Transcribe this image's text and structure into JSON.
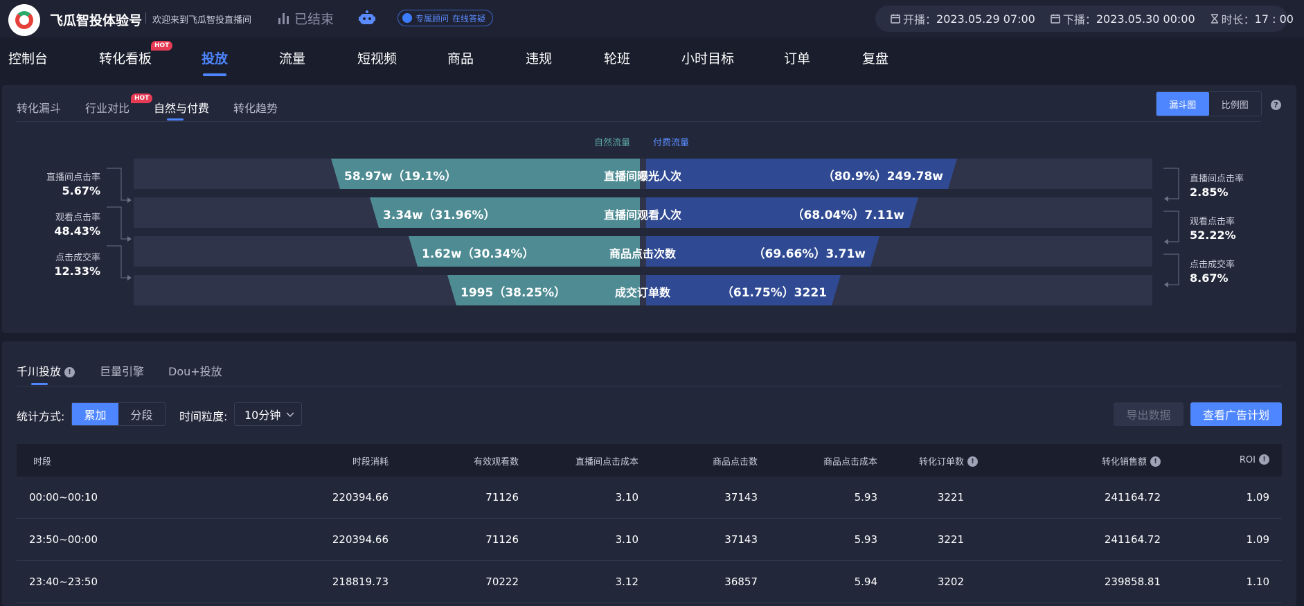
{
  "header": {
    "brand": "飞瓜智投体验号",
    "welcome": "欢迎来到飞瓜智投直播间",
    "status": "已结束",
    "advisor": {
      "prefix": "专属顾问",
      "suffix": "在线答疑"
    },
    "start_label": "开播：",
    "start_value": "2023.05.29 07:00",
    "end_label": "下播：",
    "end_value": "2023.05.30 00:00",
    "duration_label": "时长：",
    "duration_value": "17 : 00"
  },
  "nav": {
    "items": [
      "控制台",
      "转化看板",
      "投放",
      "流量",
      "短视频",
      "商品",
      "违规",
      "轮班",
      "小时目标",
      "订单",
      "复盘"
    ],
    "active_index": 2,
    "hot_label": "HOT"
  },
  "funnel_panel": {
    "tabs": [
      "转化漏斗",
      "行业对比",
      "自然与付费",
      "转化趋势"
    ],
    "active_tab": 2,
    "hot_label": "HOT",
    "view_toggle": [
      "漏斗图",
      "比例图"
    ],
    "view_active": 0,
    "help": "?",
    "legend": {
      "natural": "自然流量",
      "paid": "付费流量"
    },
    "colors": {
      "natural": "#4e8b93",
      "paid": "#2f4a93"
    },
    "stages": [
      {
        "name": "直播间曝光人次",
        "natural": "58.97w（19.1%）",
        "paid": "（80.9%）249.78w"
      },
      {
        "name": "直播间观看人次",
        "natural": "3.34w（31.96%）",
        "paid": "（68.04%）7.11w"
      },
      {
        "name": "商品点击次数",
        "natural": "1.62w（30.34%）",
        "paid": "（69.66%）3.71w"
      },
      {
        "name": "成交订单数",
        "natural": "1995（38.25%）",
        "paid": "（61.75%）3221"
      }
    ],
    "left_rates": [
      {
        "label": "直播间点击率",
        "value": "5.67%"
      },
      {
        "label": "观看点击率",
        "value": "48.43%"
      },
      {
        "label": "点击成交率",
        "value": "12.33%"
      }
    ],
    "right_rates": [
      {
        "label": "直播间点击率",
        "value": "2.85%"
      },
      {
        "label": "观看点击率",
        "value": "52.22%"
      },
      {
        "label": "点击成交率",
        "value": "8.67%"
      }
    ]
  },
  "ads_panel": {
    "tabs": [
      "千川投放",
      "巨量引擎",
      "Dou+投放"
    ],
    "active_tab": 0,
    "stat_label": "统计方式:",
    "stat_options": [
      "累加",
      "分段"
    ],
    "stat_active": 0,
    "granularity_label": "时间粒度:",
    "granularity_value": "10分钟",
    "export_button": "导出数据",
    "view_button": "查看广告计划",
    "columns": [
      "时段",
      "时段消耗",
      "有效观看数",
      "直播间点击成本",
      "商品点击数",
      "商品点击成本",
      "转化订单数",
      "转化销售额",
      "ROI"
    ],
    "rows": [
      [
        "00:00~00:10",
        "220394.66",
        "71126",
        "3.10",
        "37143",
        "5.93",
        "3221",
        "241164.72",
        "1.09"
      ],
      [
        "23:50~00:00",
        "220394.66",
        "71126",
        "3.10",
        "37143",
        "5.93",
        "3221",
        "241164.72",
        "1.09"
      ],
      [
        "23:40~23:50",
        "218819.73",
        "70222",
        "3.12",
        "36857",
        "5.94",
        "3202",
        "239858.81",
        "1.10"
      ]
    ]
  }
}
